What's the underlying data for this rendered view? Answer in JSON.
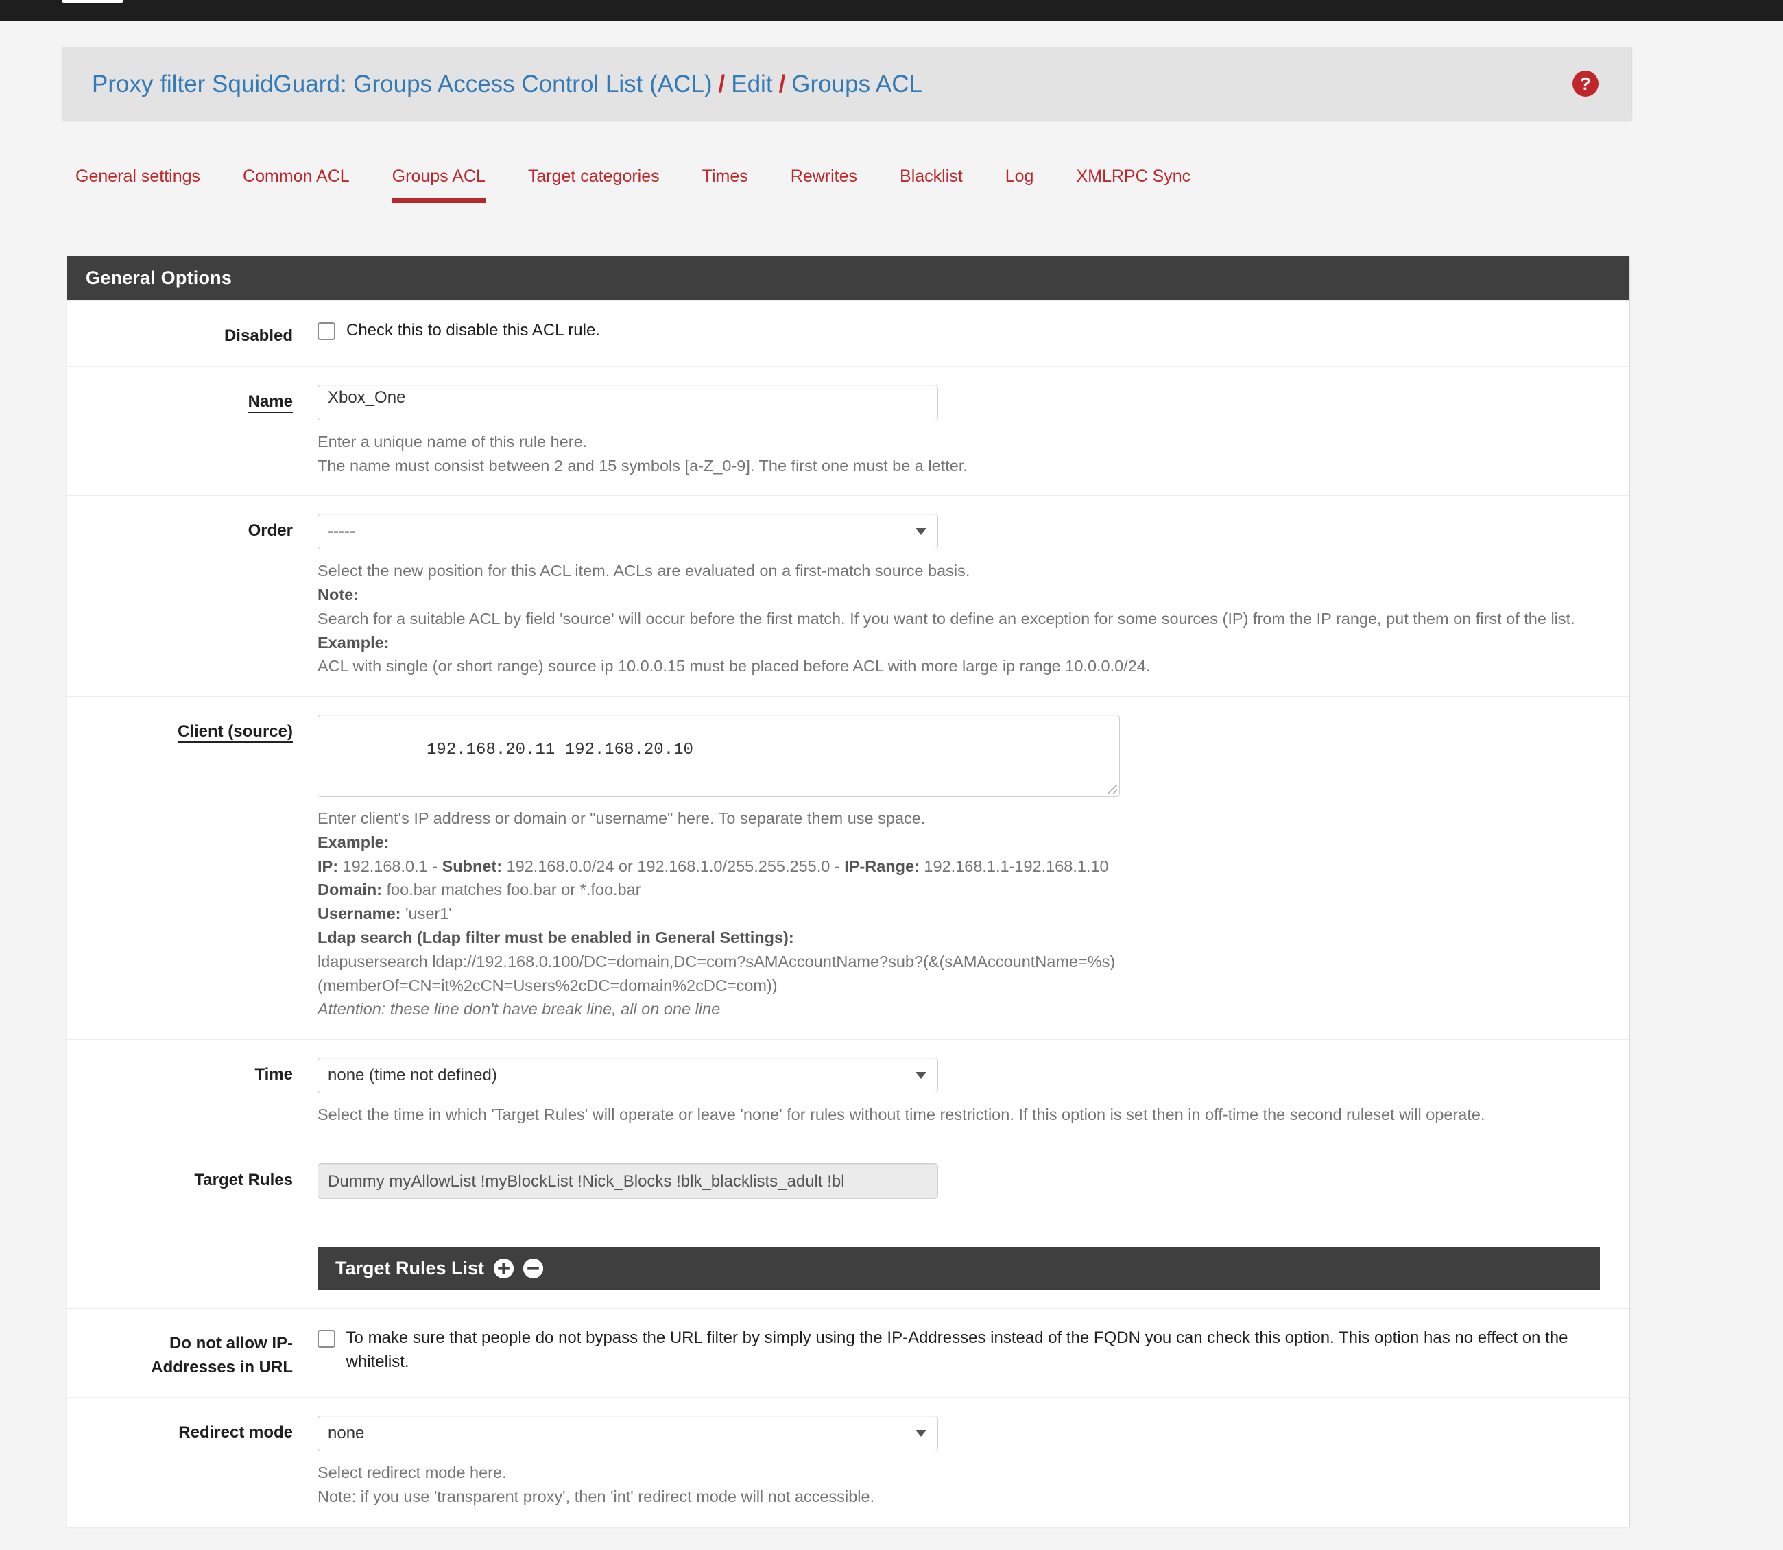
{
  "breadcrumb": {
    "part1": "Proxy filter SquidGuard: Groups Access Control List (ACL)",
    "sep1": "/",
    "part2": "Edit",
    "sep2": "/",
    "part3": "Groups ACL",
    "help_icon": "?"
  },
  "tabs": [
    {
      "label": "General settings",
      "active": false
    },
    {
      "label": "Common ACL",
      "active": false
    },
    {
      "label": "Groups ACL",
      "active": true
    },
    {
      "label": "Target categories",
      "active": false
    },
    {
      "label": "Times",
      "active": false
    },
    {
      "label": "Rewrites",
      "active": false
    },
    {
      "label": "Blacklist",
      "active": false
    },
    {
      "label": "Log",
      "active": false
    },
    {
      "label": "XMLRPC Sync",
      "active": false
    }
  ],
  "panel": {
    "header": "General Options"
  },
  "fields": {
    "disabled": {
      "label": "Disabled",
      "checkbox_label": "Check this to disable this ACL rule.",
      "checked": false
    },
    "name": {
      "label": "Name",
      "value": "Xbox_One",
      "help_line1": "Enter a unique name of this rule here.",
      "help_line2": "The name must consist between 2 and 15 symbols [a-Z_0-9]. The first one must be a letter."
    },
    "order": {
      "label": "Order",
      "value": "-----",
      "help_line1": "Select the new position for this ACL item. ACLs are evaluated on a first-match source basis.",
      "note_label": "Note:",
      "note_text": "Search for a suitable ACL by field 'source' will occur before the first match. If you want to define an exception for some sources (IP) from the IP range, put them on first of the list.",
      "example_label": "Example:",
      "example_text": "ACL with single (or short range) source ip 10.0.0.15 must be placed before ACL with more large ip range 10.0.0.0/24."
    },
    "client": {
      "label_a": "Client (",
      "label_b": "source",
      "label_c": ")",
      "value": "192.168.20.11 192.168.20.10",
      "help_line1": "Enter client's IP address or domain or \"username\" here. To separate them use space.",
      "example_label": "Example:",
      "ip_label": "IP:",
      "ip_value": " 192.168.0.1 - ",
      "subnet_label": "Subnet:",
      "subnet_value": " 192.168.0.0/24 or 192.168.1.0/255.255.255.0 - ",
      "iprange_label": "IP-Range:",
      "iprange_value": " 192.168.1.1-192.168.1.10",
      "domain_label": "Domain:",
      "domain_value": " foo.bar matches foo.bar or *.foo.bar",
      "username_label": "Username:",
      "username_value": " 'user1'",
      "ldap_label": "Ldap search (Ldap filter must be enabled in General Settings):",
      "ldap_line1": "ldapusersearch ldap://192.168.0.100/DC=domain,DC=com?sAMAccountName?sub?(&(sAMAccountName=%s)",
      "ldap_line2": "(memberOf=CN=it%2cCN=Users%2cDC=domain%2cDC=com))",
      "attention": "Attention: these line don't have break line, all on one line"
    },
    "time": {
      "label": "Time",
      "value": "none (time not defined)",
      "help_line1": "Select the time in which 'Target Rules' will operate or leave 'none' for rules without time restriction. If this option is set then in off-time the second ruleset will operate."
    },
    "target_rules": {
      "label": "Target Rules",
      "value": "Dummy myAllowList !myBlockList !Nick_Blocks !blk_blacklists_adult !bl",
      "subpanel_header": "Target Rules List",
      "add_icon": "plus-icon",
      "remove_icon": "minus-icon"
    },
    "no_ip_in_url": {
      "label_line1": "Do not allow IP-",
      "label_line2": "Addresses in URL",
      "checkbox_label": "To make sure that people do not bypass the URL filter by simply using the IP-Addresses instead of the FQDN you can check this option. This option has no effect on the whitelist.",
      "checked": false
    },
    "redirect_mode": {
      "label": "Redirect mode",
      "value": "none",
      "help_line1": "Select redirect mode here.",
      "help_line2": "Note: if you use 'transparent proxy', then 'int' redirect mode will not accessible."
    }
  },
  "colors": {
    "accent_red": "#c0272d",
    "link_blue": "#337ab7",
    "panel_header_dark": "#3f3f3f",
    "page_bg": "#f4f4f4"
  }
}
